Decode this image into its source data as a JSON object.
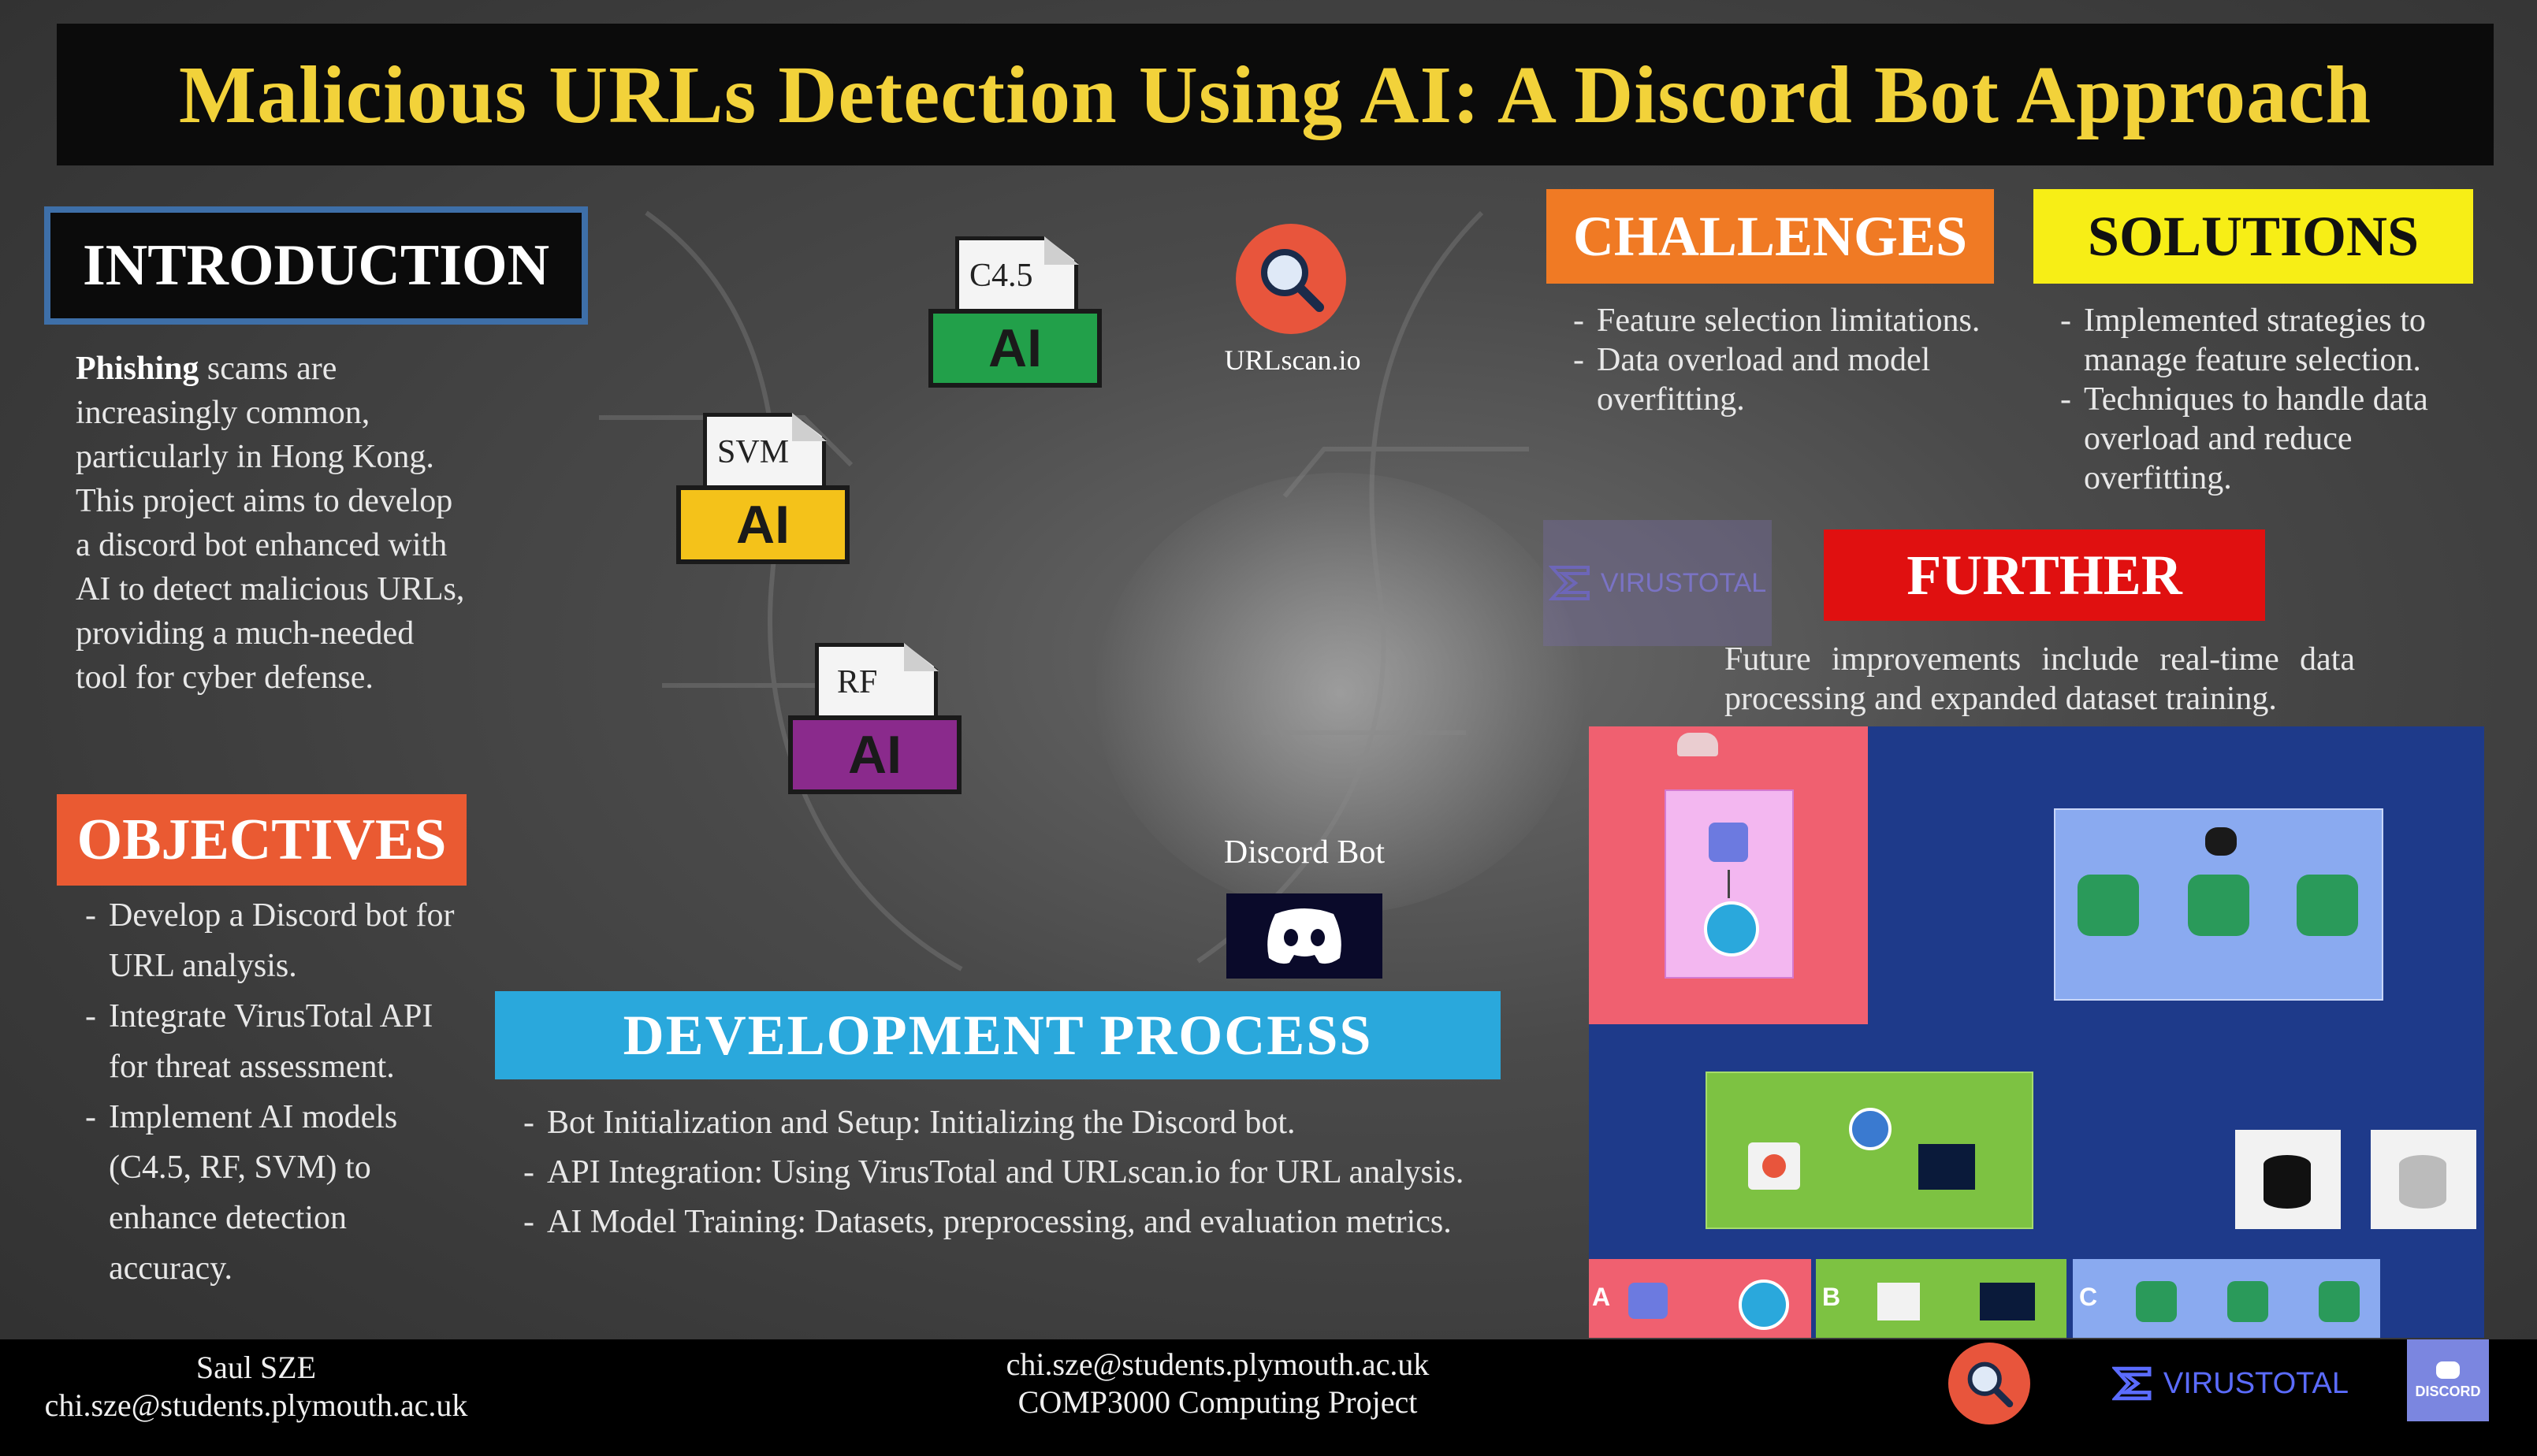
{
  "title": "Malicious URLs Detection Using AI: A Discord Bot Approach",
  "introduction": {
    "heading": "INTRODUCTION",
    "lead_word": "Phishing",
    "text": " scams are increasingly common, particularly in Hong Kong. This project aims to develop a discord bot enhanced with AI to detect malicious URLs, providing a much-needed tool for cyber defense."
  },
  "objectives": {
    "heading": "OBJECTIVES",
    "items": [
      "Develop a Discord bot for URL analysis.",
      "Integrate VirusTotal API for threat assessment.",
      "Implement AI models (C4.5, RF, SVM) to enhance detection accuracy."
    ]
  },
  "models": [
    {
      "label": "C4.5",
      "band_text": "AI",
      "color": "#22a04a"
    },
    {
      "label": "SVM",
      "band_text": "AI",
      "color": "#f4c21a"
    },
    {
      "label": "RF",
      "band_text": "AI",
      "color": "#8a2a8c"
    }
  ],
  "urlscan_caption": "URLscan.io",
  "discord_caption": "Discord Bot",
  "challenges": {
    "heading": "CHALLENGES",
    "items": [
      "Feature selection limitations.",
      "Data overload and model overfitting."
    ]
  },
  "solutions": {
    "heading": "SOLUTIONS",
    "items": [
      "Implemented strategies to manage feature selection.",
      "Techniques to handle data overload and reduce overfitting."
    ]
  },
  "further": {
    "heading": "FURTHER",
    "text": "Future improvements include real-time data processing and expanded dataset training."
  },
  "development": {
    "heading": "DEVELOPMENT PROCESS",
    "items": [
      "Bot Initialization and Setup: Initializing the Discord bot.",
      "API Integration: Using VirusTotal and URLscan.io for URL analysis.",
      "AI Model Training: Datasets, preprocessing, and evaluation metrics."
    ]
  },
  "virustotal_watermark": "VIRUSTOTAL",
  "architecture_labels": [
    "A",
    "B",
    "C"
  ],
  "footer": {
    "left_name": "Saul SZE",
    "left_email": "chi.sze@students.plymouth.ac.uk",
    "center_email": "chi.sze@students.plymouth.ac.uk",
    "center_course": "COMP3000 Computing Project",
    "virustotal_logo": "VIRUSTOTAL",
    "discord_logo": "DISCORD"
  },
  "colors": {
    "title_yellow": "#f2d23a",
    "challenges": "#f07a24",
    "solutions": "#f7ee16",
    "further": "#e01010",
    "development": "#2aa8dc",
    "objectives": "#ea5a32"
  }
}
